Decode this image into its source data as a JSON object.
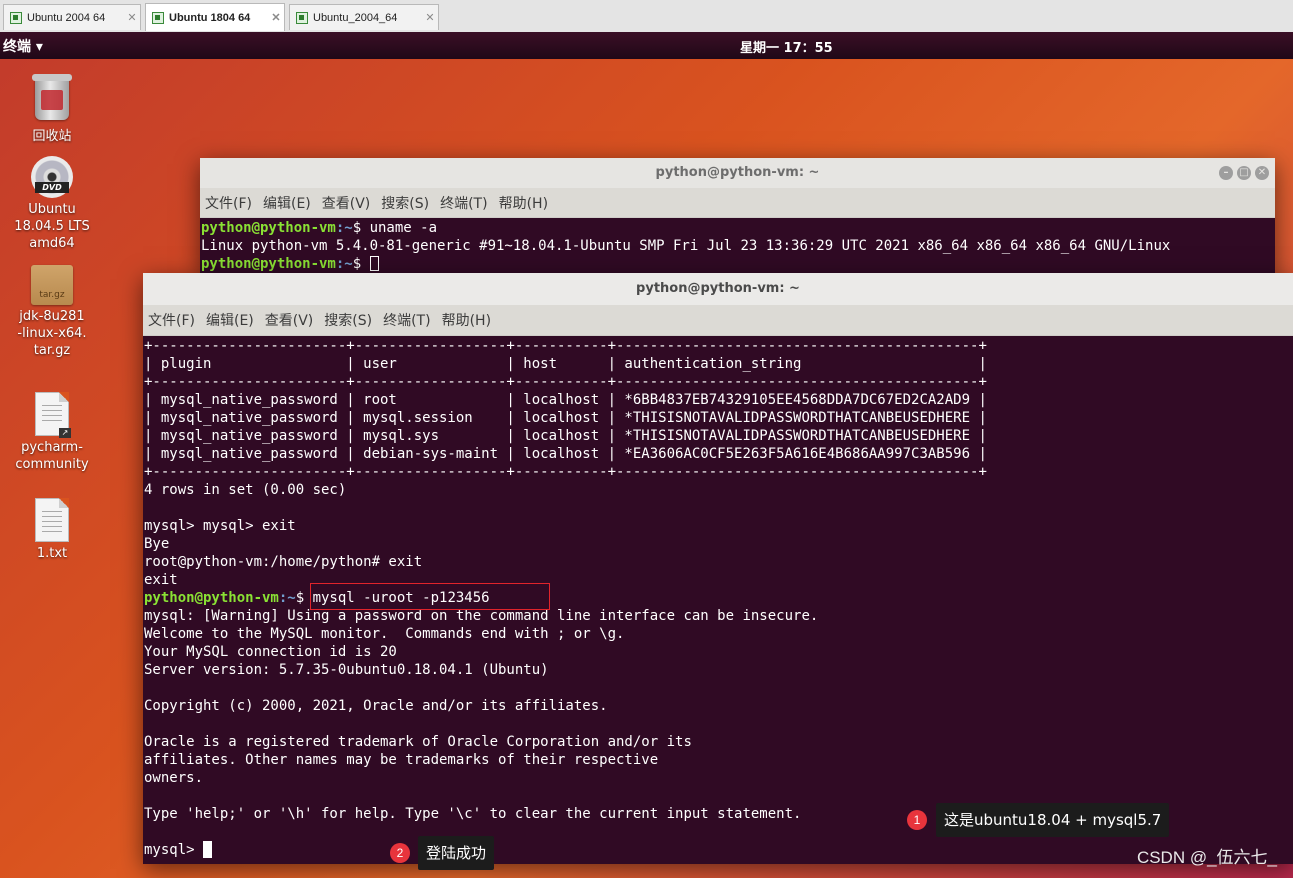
{
  "vm_tabs": [
    {
      "label": "Ubuntu 2004 64",
      "active": false
    },
    {
      "label": "Ubuntu 1804 64",
      "active": true
    },
    {
      "label": "Ubuntu_2004_64",
      "active": false
    }
  ],
  "topbar": {
    "app_menu": "终端 ▾",
    "clock": "星期一 17：55"
  },
  "desktop_icons": [
    {
      "icon": "trash-icon",
      "label": "回收站"
    },
    {
      "icon": "dvd-icon",
      "label": "Ubuntu 18.04.5 LTS amd64",
      "badge": "DVD"
    },
    {
      "icon": "archive-icon",
      "label": "jdk-8u281-linux-x64.tar.gz",
      "badge": "tar.gz"
    },
    {
      "icon": "script-icon",
      "label": "pycharm-community"
    },
    {
      "icon": "text-file-icon",
      "label": "1.txt"
    }
  ],
  "terminal_back": {
    "title": "python@python-vm: ~",
    "menu": [
      "文件(F)",
      "编辑(E)",
      "查看(V)",
      "搜索(S)",
      "终端(T)",
      "帮助(H)"
    ],
    "prompt_user": "python@python-vm",
    "prompt_path": ":~",
    "prompt_sign": "$ ",
    "command": "uname -a",
    "output": "Linux python-vm 5.4.0-81-generic #91~18.04.1-Ubuntu SMP Fri Jul 23 13:36:29 UTC 2021 x86_64 x86_64 x86_64 GNU/Linux"
  },
  "terminal_front": {
    "title": "python@python-vm: ~",
    "menu": [
      "文件(F)",
      "编辑(E)",
      "查看(V)",
      "搜索(S)",
      "终端(T)",
      "帮助(H)"
    ],
    "table": {
      "border": "+-----------------------+------------------+-----------+-------------------------------------------+",
      "header": "| plugin                | user             | host      | authentication_string                     |",
      "rows": [
        "| mysql_native_password | root             | localhost | *6BB4837EB74329105EE4568DDA7DC67ED2CA2AD9 |",
        "| mysql_native_password | mysql.session    | localhost | *THISISNOTAVALIDPASSWORDTHATCANBEUSEDHERE |",
        "| mysql_native_password | mysql.sys        | localhost | *THISISNOTAVALIDPASSWORDTHATCANBEUSEDHERE |",
        "| mysql_native_password | debian-sys-maint | localhost | *EA3606AC0CF5E263F5A616E4B686AA997C3AB596 |"
      ]
    },
    "rows_in_set": "4 rows in set (0.00 sec)",
    "exit_lines": [
      "mysql> mysql> exit",
      "Bye",
      "root@python-vm:/home/python# exit",
      "exit"
    ],
    "prompt_user": "python@python-vm",
    "prompt_path": ":~",
    "prompt_sign": "$ ",
    "login_command": "mysql -uroot -p123456",
    "welcome_lines": [
      "mysql: [Warning] Using a password on the command line interface can be insecure.",
      "Welcome to the MySQL monitor.  Commands end with ; or \\g.",
      "Your MySQL connection id is 20",
      "Server version: 5.7.35-0ubuntu0.18.04.1 (Ubuntu)",
      "",
      "Copyright (c) 2000, 2021, Oracle and/or its affiliates.",
      "",
      "Oracle is a registered trademark of Oracle Corporation and/or its",
      "affiliates. Other names may be trademarks of their respective",
      "owners.",
      "",
      "Type 'help;' or '\\h' for help. Type '\\c' to clear the current input statement.",
      ""
    ],
    "mysql_prompt": "mysql> "
  },
  "annotations": {
    "note1": {
      "badge": "1",
      "text": "这是ubuntu18.04 + mysql5.7"
    },
    "note2": {
      "badge": "2",
      "text": "登陆成功"
    }
  },
  "watermark": "CSDN @_伍六七_",
  "colors": {
    "prompt_user": "#8ae234",
    "prompt_path": "#729fcf",
    "terminal_bg": "#300a24",
    "highlight": "#e0242b",
    "badge": "#e8343c"
  }
}
